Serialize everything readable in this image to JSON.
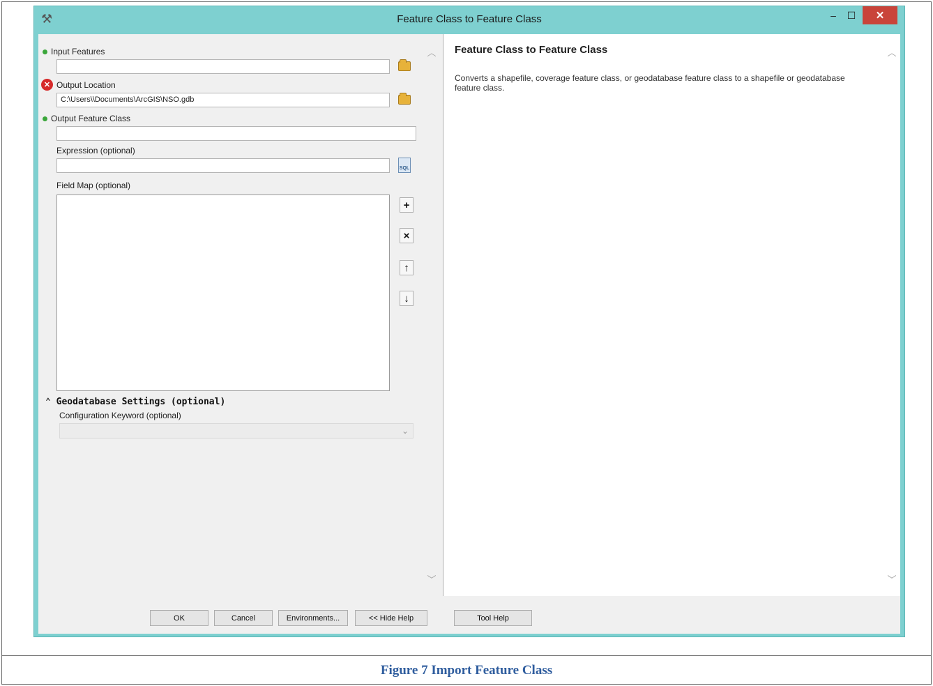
{
  "window": {
    "title": "Feature Class to Feature Class",
    "minimize": "–",
    "maximize": "☐",
    "close": "✕"
  },
  "params": {
    "input_features": {
      "label": "Input Features",
      "value": ""
    },
    "output_location": {
      "label": "Output Location",
      "value": "C:\\Users\\\\Documents\\ArcGIS\\NSO.gdb"
    },
    "output_feature_class": {
      "label": "Output Feature Class",
      "value": ""
    },
    "expression": {
      "label": "Expression (optional)",
      "value": "",
      "sql_text": "SQL"
    },
    "field_map": {
      "label": "Field Map (optional)"
    },
    "geodatabase_settings": {
      "header": "Geodatabase Settings (optional)",
      "toggle": "⌃"
    },
    "config_keyword": {
      "label": "Configuration Keyword (optional)",
      "value": ""
    }
  },
  "field_map_buttons": {
    "add": "+",
    "remove": "×",
    "up": "↑",
    "down": "↓"
  },
  "help": {
    "title": "Feature Class to Feature Class",
    "description": "Converts a shapefile, coverage feature class, or geodatabase feature class to a shapefile or geodatabase feature class."
  },
  "buttons": {
    "ok": "OK",
    "cancel": "Cancel",
    "environments": "Environments...",
    "hide_help": "<< Hide Help",
    "tool_help": "Tool Help"
  },
  "caption": "Figure 7 Import Feature Class"
}
